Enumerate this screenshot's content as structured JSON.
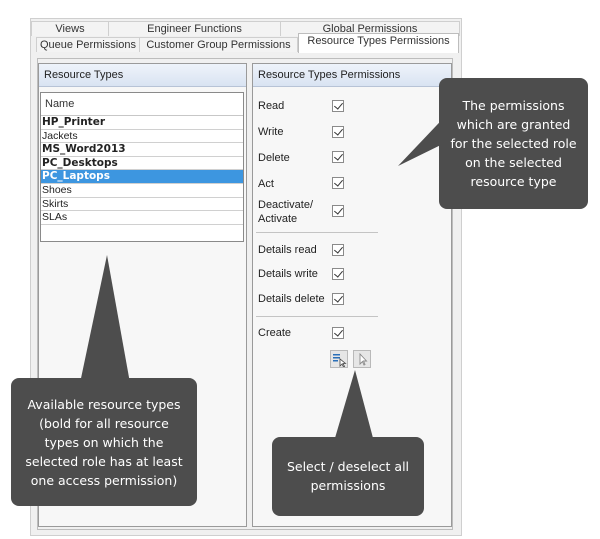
{
  "tabs": {
    "row1": [
      "Views",
      "Engineer Functions",
      "Global Permissions"
    ],
    "row2": [
      "Queue Permissions",
      "Customer Group Permissions",
      "Resource Types Permissions"
    ]
  },
  "left_panel": {
    "title": "Resource Types",
    "list_header": "Name",
    "items": [
      {
        "label": "HP_Printer",
        "bold": true,
        "selected": false
      },
      {
        "label": "Jackets",
        "bold": false,
        "selected": false
      },
      {
        "label": "MS_Word2013",
        "bold": true,
        "selected": false
      },
      {
        "label": "PC_Desktops",
        "bold": true,
        "selected": false
      },
      {
        "label": "PC_Laptops",
        "bold": true,
        "selected": true
      },
      {
        "label": "Shoes",
        "bold": false,
        "selected": false
      },
      {
        "label": "Skirts",
        "bold": false,
        "selected": false
      },
      {
        "label": "SLAs",
        "bold": false,
        "selected": false
      }
    ]
  },
  "right_panel": {
    "title": "Resource Types Permissions",
    "permissions": {
      "read": "Read",
      "write": "Write",
      "delete": "Delete",
      "act": "Act",
      "deactivate_1": "Deactivate/",
      "deactivate_2": "Activate",
      "details_read": "Details read",
      "details_write": "Details write",
      "details_delete": "Details delete",
      "create": "Create"
    }
  },
  "callouts": {
    "permissions": [
      "The permissions",
      "which are granted",
      "for the selected role",
      "on the selected",
      "resource type"
    ],
    "resource_types": [
      "Available resource types",
      "(bold for all resource",
      "types on which the",
      "selected role has at least",
      "one access permission)"
    ],
    "select_all": [
      "Select / deselect all",
      "permissions"
    ]
  }
}
